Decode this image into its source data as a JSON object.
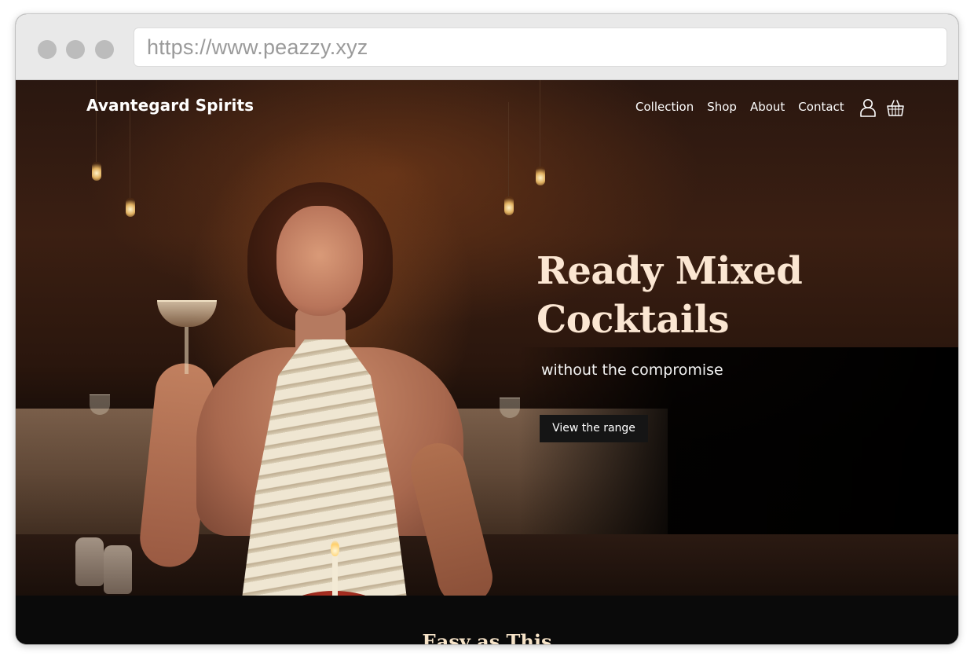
{
  "browser": {
    "url": "https://www.peazzy.xyz"
  },
  "site": {
    "brand": "Avantegard Spirits",
    "nav": [
      {
        "label": "Collection"
      },
      {
        "label": "Shop"
      },
      {
        "label": "About"
      },
      {
        "label": "Contact"
      }
    ],
    "icons": [
      "user-icon",
      "basket-icon"
    ]
  },
  "hero": {
    "title_line1": "Ready Mixed",
    "title_line2": "Cocktails",
    "subtitle": "without the compromise",
    "cta_label": "View the range"
  },
  "next_section": {
    "title": "Easy as This"
  },
  "colors": {
    "heading": "#fbe6d2",
    "button_bg": "#151515",
    "page_dark": "#0a0a0a"
  }
}
